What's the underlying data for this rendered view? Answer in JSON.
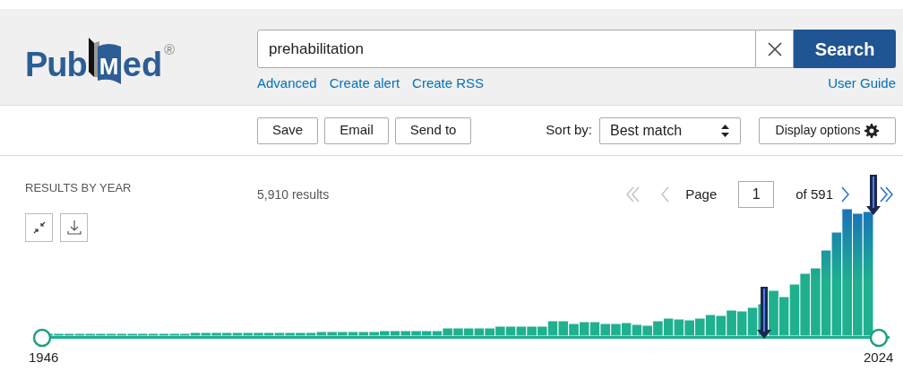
{
  "header": {
    "logo": {
      "before": "Pub",
      "book_letter": "M",
      "after": "ed",
      "mark": "®"
    },
    "search": {
      "value": "prehabilitation",
      "button": "Search"
    },
    "links": [
      "Advanced",
      "Create alert",
      "Create RSS"
    ],
    "user_guide": "User Guide"
  },
  "toolbar": {
    "actions": [
      "Save",
      "Email",
      "Send to"
    ],
    "sort_label": "Sort by:",
    "sort_value": "Best match",
    "display_options": "Display options"
  },
  "results": {
    "title": "RESULTS BY YEAR",
    "count": "5,910 results",
    "pager": {
      "first_disabled": true,
      "prev_disabled": true,
      "next_disabled": false,
      "last_disabled": false,
      "page_label": "Page",
      "page": "1",
      "of": "of 591"
    },
    "year_start": "1946",
    "year_end": "2024"
  }
}
